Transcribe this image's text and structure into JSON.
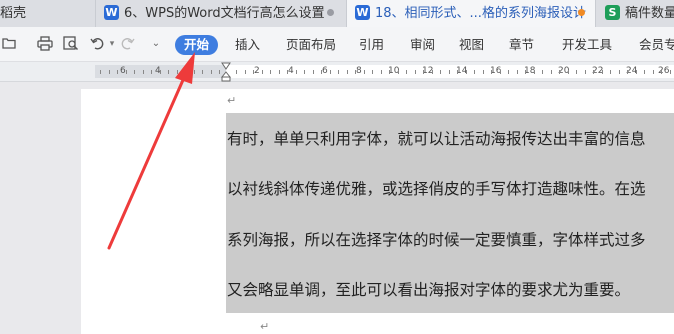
{
  "tabs": [
    {
      "label": "稻壳",
      "icon": "",
      "icon_color": ""
    },
    {
      "label": "6、WPS的Word文档行高怎么设置",
      "icon": "W",
      "icon_color": "#2b6bd6"
    },
    {
      "label": "18、相同形式、...格的系列海报设计",
      "icon": "W",
      "icon_color": "#2b6bd6"
    },
    {
      "label": "稿件数量",
      "icon": "S",
      "icon_color": "#1e9e59"
    }
  ],
  "quick_access": {
    "folder_icon": "folder-icon",
    "print_icon": "print-icon",
    "preview_icon": "print-preview-icon",
    "undo_icon": "undo-icon",
    "redo_icon": "redo-icon",
    "more_icon": "chevron-down-icon"
  },
  "menu": {
    "items": [
      "开始",
      "插入",
      "页面布局",
      "引用",
      "审阅",
      "视图",
      "章节",
      "开发工具",
      "会员专"
    ],
    "active_index": 0
  },
  "ruler": {
    "left_numbers": [
      "6",
      "4",
      "2"
    ],
    "right_numbers": [
      "2",
      "4",
      "6",
      "8",
      "10",
      "12",
      "14",
      "16",
      "18",
      "20",
      "22",
      "24",
      "26"
    ]
  },
  "document": {
    "paragraph_mark": "↵",
    "lines": [
      "有时，单单只利用字体，就可以让活动海报传达出丰富的信息",
      "以衬线斜体传递优雅，或选择俏皮的手写体打造趣味性。在选",
      "系列海报，所以在选择字体的时候一定要慎重，字体样式过多",
      "又会略显单调，至此可以看出海报对字体的要求尤为重要。"
    ],
    "end_mark": "↵",
    "highlight_color": "#cbcbcb"
  },
  "annotation": {
    "arrow_color": "#ee3b3b"
  }
}
